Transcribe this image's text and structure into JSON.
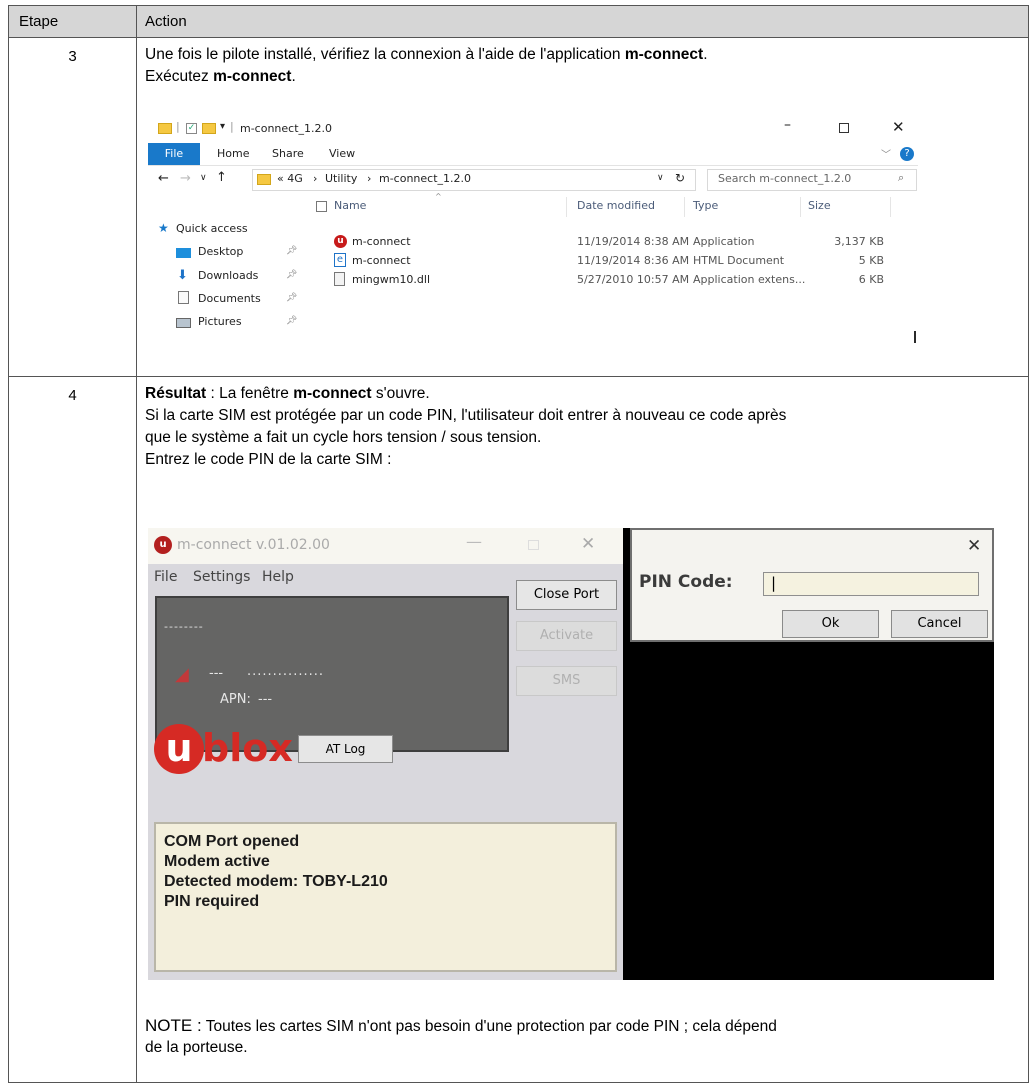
{
  "table": {
    "header": {
      "step": "Etape",
      "action": "Action"
    },
    "rows": [
      {
        "step": "3",
        "line1_pre": "Une fois le pilote installé, vérifiez la connexion à l'aide de l'application ",
        "line1_bold": "m-connect",
        "line1_post": ".",
        "line2_pre": "Exécutez ",
        "line2_bold": "m-connect",
        "line2_post": "."
      },
      {
        "step": "4",
        "line1_bold": "Résultat",
        "line1_mid": " : La fenêtre ",
        "line1_bold2": "m-connect",
        "line1_post": " s'ouvre.",
        "line2": "Si la carte SIM est protégée par un code PIN, l'utilisateur doit entrer à nouveau ce code après",
        "line3": "que le système a fait un cycle hors tension / sous tension.",
        "line4": "Entrez le code PIN de la carte SIM :",
        "note_label": "NOTE :",
        "note_line1": " Toutes les cartes SIM n'ont pas besoin d'une protection par code PIN ; cela dépend",
        "note_line2": "de la porteuse."
      }
    ]
  },
  "explorer": {
    "title": "m-connect_1.2.0",
    "tabs": [
      "File",
      "Home",
      "Share",
      "View"
    ],
    "path": [
      "« 4G",
      "Utility",
      "m-connect_1.2.0"
    ],
    "search_placeholder": "Search m-connect_1.2.0",
    "nav": [
      "Quick access",
      "Desktop",
      "Downloads",
      "Documents",
      "Pictures"
    ],
    "columns": [
      "Name",
      "Date modified",
      "Type",
      "Size"
    ],
    "files": [
      {
        "name": "m-connect",
        "date": "11/19/2014 8:38 AM",
        "type": "Application",
        "size": "3,137 KB",
        "icon": "app-icon"
      },
      {
        "name": "m-connect",
        "date": "11/19/2014 8:36 AM",
        "type": "HTML Document",
        "size": "5 KB",
        "icon": "html-icon"
      },
      {
        "name": "mingwm10.dll",
        "date": "5/27/2010 10:57 AM",
        "type": "Application extens...",
        "size": "6 KB",
        "icon": "dll-icon"
      }
    ]
  },
  "mconnect": {
    "title": "m-connect v.01.02.00",
    "menu": [
      "File",
      "Settings",
      "Help"
    ],
    "panel_dashes": "--------",
    "panel_signal": "---",
    "panel_dots": "...............",
    "apn_label": "APN:",
    "apn_value": "---",
    "buttons": {
      "close_port": "Close Port",
      "activate": "Activate",
      "sms": "SMS",
      "at_log": "AT Log"
    },
    "logo": "blox",
    "log": [
      "COM Port opened",
      "Modem active",
      "Detected modem: TOBY-L210",
      "PIN required"
    ]
  },
  "pin_dialog": {
    "label": "PIN Code:",
    "value": "|",
    "ok": "Ok",
    "cancel": "Cancel"
  }
}
